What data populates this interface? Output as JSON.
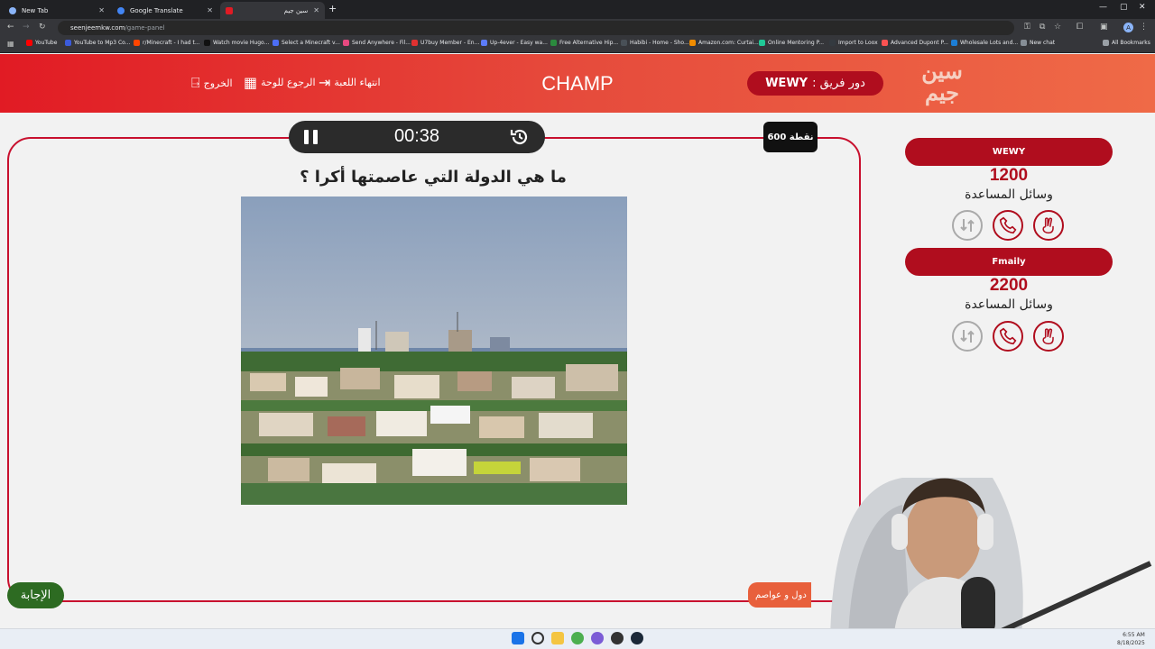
{
  "browser": {
    "tabs": [
      {
        "label": "New Tab"
      },
      {
        "label": "Google Translate"
      },
      {
        "label": "سين جيم"
      }
    ],
    "url_host": "seenjeemkw.com",
    "url_path": "/game-panel",
    "profile_initial": "A",
    "bookmarks": [
      {
        "label": "YouTube",
        "color": "#ff0000"
      },
      {
        "label": "YouTube to Mp3 Co...",
        "color": "#3b5bdb"
      },
      {
        "label": "r/Minecraft - I had t...",
        "color": "#ff4500"
      },
      {
        "label": "Watch movie Hugo...",
        "color": "#222222"
      },
      {
        "label": "Select a Minecraft v...",
        "color": "#4c6ef5"
      },
      {
        "label": "Send Anywhere - Fil...",
        "color": "#e64980"
      },
      {
        "label": "U7buy Member - En...",
        "color": "#e03131"
      },
      {
        "label": "Up-4ever - Easy wa...",
        "color": "#5c7cfa"
      },
      {
        "label": "Free Alternative Hip...",
        "color": "#2b8a3e"
      },
      {
        "label": "Habibi - Home - Sho...",
        "color": "#495057"
      },
      {
        "label": "Amazon.com: Curtai...",
        "color": "#f08c00"
      },
      {
        "label": "Online Mentoring P...",
        "color": "#20c997"
      },
      {
        "label": "Import to Loox",
        "color": "#343a40"
      },
      {
        "label": "Advanced Dupont P...",
        "color": "#fa5252"
      },
      {
        "label": "Wholesale Lots and...",
        "color": "#1c7ed6"
      },
      {
        "label": "New chat",
        "color": "#868e96"
      }
    ],
    "all_bookmarks": "All Bookmarks"
  },
  "header": {
    "logo_text": "سين جيم",
    "turn_label": "دور فريق :",
    "turn_team": "WEWY",
    "game_name": "CHAMP",
    "end_game": "انتهاء اللعبة",
    "back_to_board": "الرجوع للوحة",
    "exit": "الخروج"
  },
  "question": {
    "timer": "00:38",
    "points": "600 نقطة",
    "text": "ما هي الدولة التي عاصمتها أكرا ؟",
    "answer_button": "الإجابة",
    "category": "دول و عواصم"
  },
  "teams": [
    {
      "name": "WEWY",
      "score": "1200",
      "aids_label": "وسائل المساعدة"
    },
    {
      "name": "Fmaily",
      "score": "2200",
      "aids_label": "وسائل المساعدة"
    }
  ],
  "colors": {
    "brand_red": "#b00d1e",
    "header_gradient_start": "#e11b24",
    "header_gradient_end": "#ef6a47",
    "answer_green": "#2d6b22"
  },
  "taskbar": {
    "time": "6:55 AM",
    "date": "8/18/2025"
  }
}
